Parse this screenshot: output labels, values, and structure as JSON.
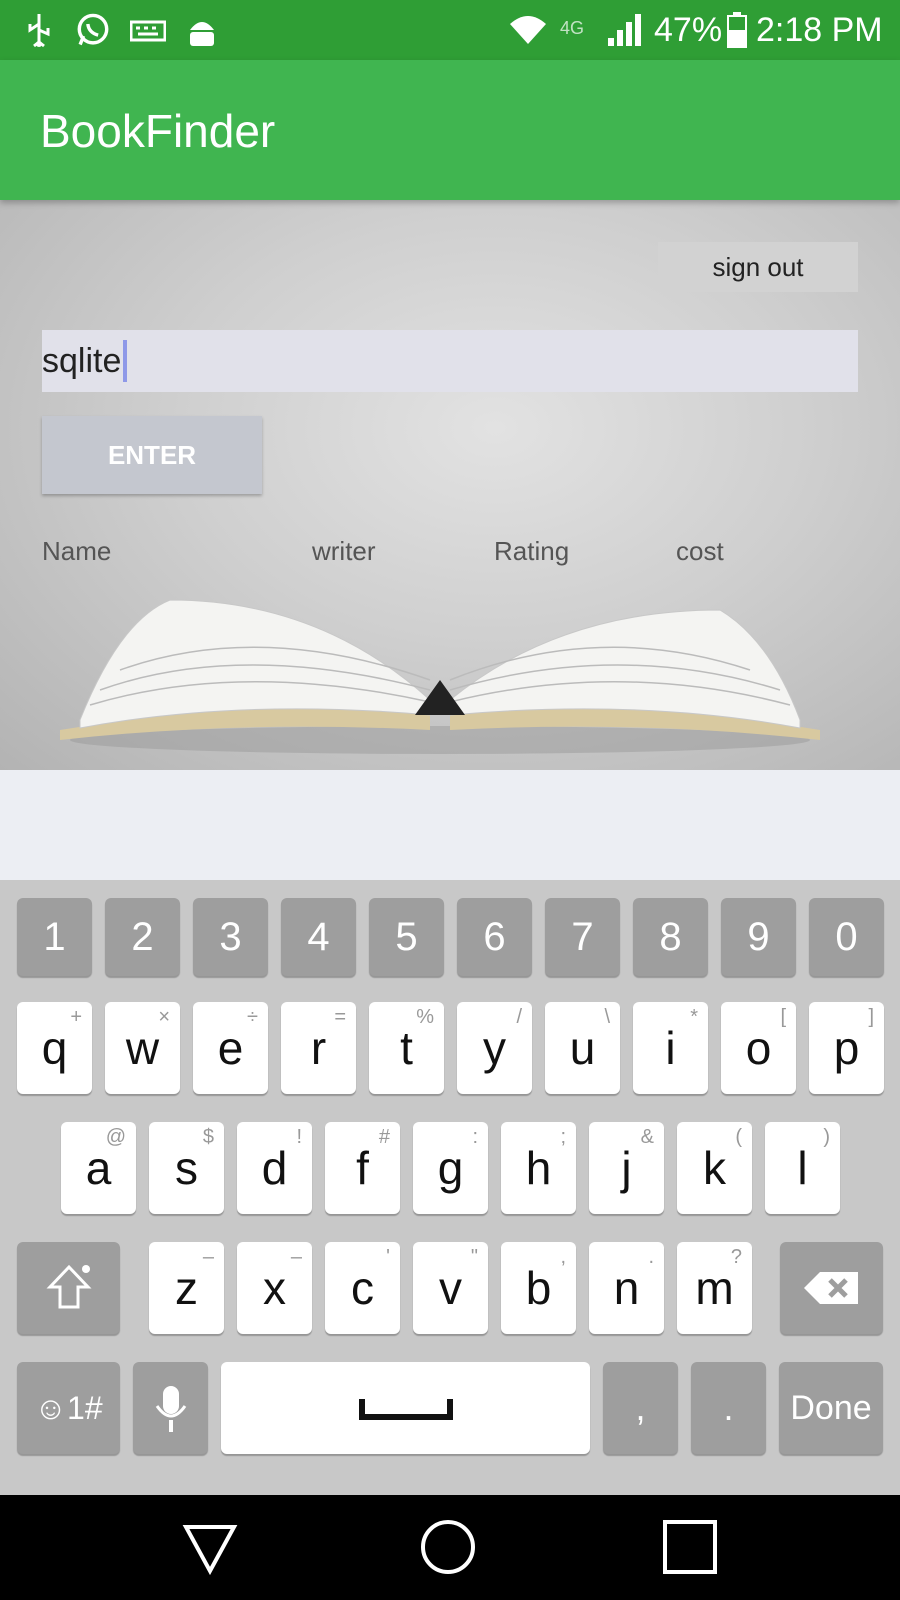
{
  "status_bar": {
    "battery": "47%",
    "time": "2:18 PM",
    "network": "4G",
    "icons": [
      "usb-icon",
      "whatsapp-icon",
      "keyboard-icon",
      "android-debug-icon",
      "wifi-icon",
      "signal-icon",
      "battery-icon"
    ]
  },
  "app_bar": {
    "title": "BookFinder"
  },
  "main": {
    "sign_out_label": "sign out",
    "search": {
      "value": "sqlite"
    },
    "enter_label": "ENTER",
    "columns": [
      "Name",
      "writer",
      "Rating",
      "cost"
    ]
  },
  "keyboard": {
    "number_row": [
      "1",
      "2",
      "3",
      "4",
      "5",
      "6",
      "7",
      "8",
      "9",
      "0"
    ],
    "row1": [
      {
        "key": "q",
        "alt": "+"
      },
      {
        "key": "w",
        "alt": "×"
      },
      {
        "key": "e",
        "alt": "÷"
      },
      {
        "key": "r",
        "alt": "="
      },
      {
        "key": "t",
        "alt": "%"
      },
      {
        "key": "y",
        "alt": "/"
      },
      {
        "key": "u",
        "alt": "\\"
      },
      {
        "key": "i",
        "alt": "*"
      },
      {
        "key": "o",
        "alt": "["
      },
      {
        "key": "p",
        "alt": "]"
      }
    ],
    "row2": [
      {
        "key": "a",
        "alt": "@"
      },
      {
        "key": "s",
        "alt": "$"
      },
      {
        "key": "d",
        "alt": "!"
      },
      {
        "key": "f",
        "alt": "#"
      },
      {
        "key": "g",
        "alt": ":"
      },
      {
        "key": "h",
        "alt": ";"
      },
      {
        "key": "j",
        "alt": "&"
      },
      {
        "key": "k",
        "alt": "("
      },
      {
        "key": "l",
        "alt": ")"
      }
    ],
    "row3": [
      {
        "key": "z",
        "alt": "–"
      },
      {
        "key": "x",
        "alt": "–"
      },
      {
        "key": "c",
        "alt": "'"
      },
      {
        "key": "v",
        "alt": "\""
      },
      {
        "key": "b",
        "alt": ","
      },
      {
        "key": "n",
        "alt": "."
      },
      {
        "key": "m",
        "alt": "?"
      }
    ],
    "symbols_label": "☺1#",
    "comma_label": ",",
    "period_label": ".",
    "done_label": "Done"
  },
  "colors": {
    "status_bar": "#2f9e35",
    "app_bar": "#40b550",
    "nav_bar": "#000000"
  }
}
